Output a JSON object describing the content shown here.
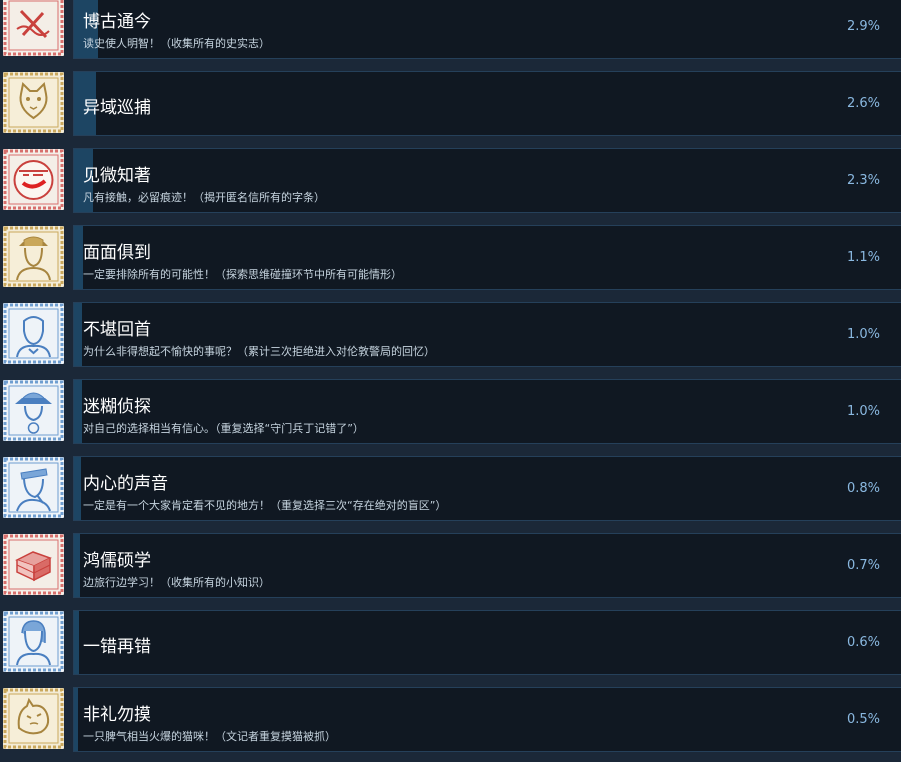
{
  "colors": {
    "background": "#1b2838",
    "card": "#101822",
    "card_border": "#25405a",
    "progress_fill": "#1d4563",
    "percent_text": "#8ab8e0"
  },
  "achievements": [
    {
      "title": "博古通今",
      "desc": "读史使人明智！（收集所有的史实志）",
      "percent": "2.9%",
      "icon": "history-scroll-icon",
      "theme": "red"
    },
    {
      "title": "异域巡捕",
      "desc": "",
      "percent": "2.6%",
      "icon": "cat-portrait-icon",
      "theme": "gold"
    },
    {
      "title": "见微知著",
      "desc": "凡有接触，必留痕迹！（揭开匿名信所有的字条）",
      "percent": "2.3%",
      "icon": "anonymous-letter-icon",
      "theme": "red"
    },
    {
      "title": "面面俱到",
      "desc": "一定要排除所有的可能性！（探索思维碰撞环节中所有可能情形）",
      "percent": "1.1%",
      "icon": "detective-hat-portrait-icon",
      "theme": "gold"
    },
    {
      "title": "不堪回首",
      "desc": "为什么非得想起不愉快的事呢？（累计三次拒绝进入对伦敦警局的回忆）",
      "percent": "1.0%",
      "icon": "gentleman-portrait-icon",
      "theme": "blue"
    },
    {
      "title": "迷糊侦探",
      "desc": "对自己的选择相当有信心。（重复选择“守门兵丁记错了”）",
      "percent": "1.0%",
      "icon": "hat-detective-portrait-icon",
      "theme": "blue"
    },
    {
      "title": "内心的声音",
      "desc": "一定是有一个大家肯定看不见的地方！（重复选择三次“存在绝对的盲区”）",
      "percent": "0.8%",
      "icon": "thinking-man-portrait-icon",
      "theme": "blue"
    },
    {
      "title": "鸿儒硕学",
      "desc": "边旅行边学习！（收集所有的小知识）",
      "percent": "0.7%",
      "icon": "stacked-books-icon",
      "theme": "red"
    },
    {
      "title": "一错再错",
      "desc": "",
      "percent": "0.6%",
      "icon": "woman-portrait-icon",
      "theme": "blue"
    },
    {
      "title": "非礼勿摸",
      "desc": "一只脾气相当火爆的猫咪！（文记者重复摸猫被抓）",
      "percent": "0.5%",
      "icon": "angry-cat-icon",
      "theme": "gold"
    }
  ]
}
